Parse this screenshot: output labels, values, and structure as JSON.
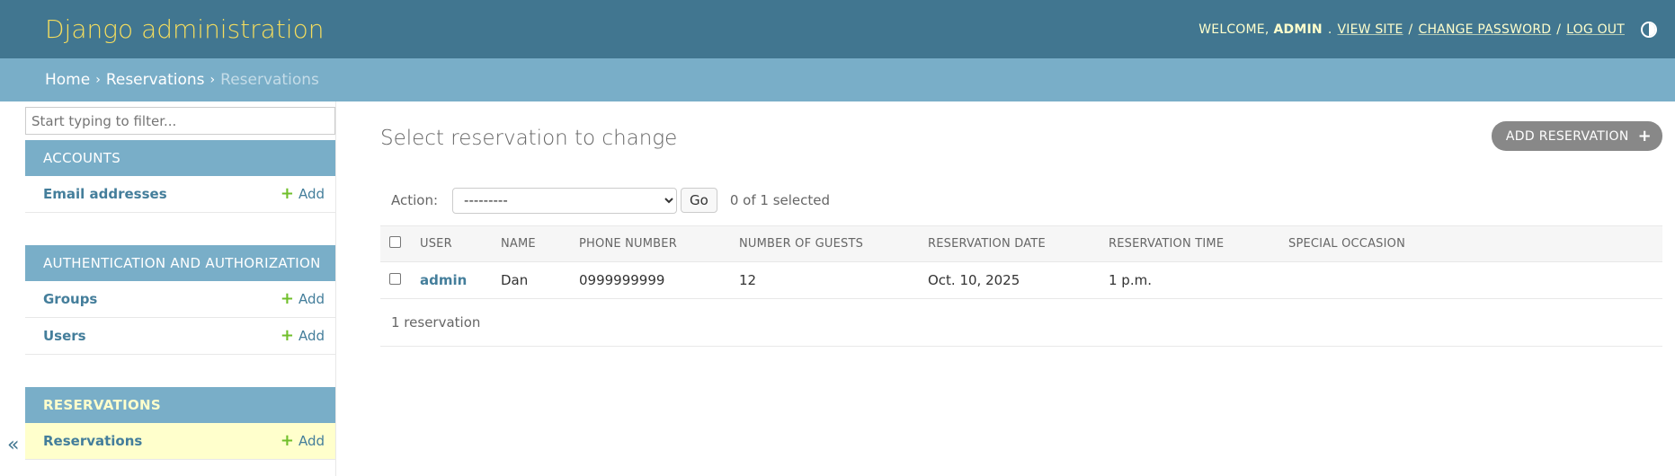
{
  "header": {
    "branding": "Django administration",
    "welcome": "WELCOME,",
    "username": "ADMIN",
    "view_site": "VIEW SITE",
    "change_password": "CHANGE PASSWORD",
    "log_out": "LOG OUT",
    "separator": "/"
  },
  "breadcrumbs": {
    "home": "Home",
    "app": "Reservations",
    "current": "Reservations",
    "arrow": "›"
  },
  "sidebar": {
    "filter_placeholder": "Start typing to filter...",
    "toggle": "«",
    "add_label": "Add",
    "modules": [
      {
        "caption": "ACCOUNTS",
        "items": [
          {
            "label": "Email addresses"
          }
        ]
      },
      {
        "caption": "AUTHENTICATION AND AUTHORIZATION",
        "items": [
          {
            "label": "Groups"
          },
          {
            "label": "Users"
          }
        ]
      },
      {
        "caption": "RESERVATIONS",
        "items": [
          {
            "label": "Reservations"
          }
        ]
      }
    ]
  },
  "content": {
    "title": "Select reservation to change",
    "add_button": "ADD RESERVATION",
    "action_label": "Action:",
    "action_selected": "---------",
    "go_button": "Go",
    "selected_counter": "0 of 1 selected",
    "table": {
      "headers": [
        "USER",
        "NAME",
        "PHONE NUMBER",
        "NUMBER OF GUESTS",
        "RESERVATION DATE",
        "RESERVATION TIME",
        "SPECIAL OCCASION"
      ],
      "rows": [
        {
          "user": "admin",
          "name": "Dan",
          "phone": "0999999999",
          "guests": "12",
          "date": "Oct. 10, 2025",
          "time": "1 p.m.",
          "occasion": ""
        }
      ]
    },
    "paginator": "1 reservation"
  },
  "colors": {
    "header_bg": "#417690",
    "breadcrumbs_bg": "#79aec8",
    "branding": "#f5dd5d",
    "link": "#447e9b",
    "add_plus": "#70bf2b",
    "current_row": "#ffffcc"
  }
}
